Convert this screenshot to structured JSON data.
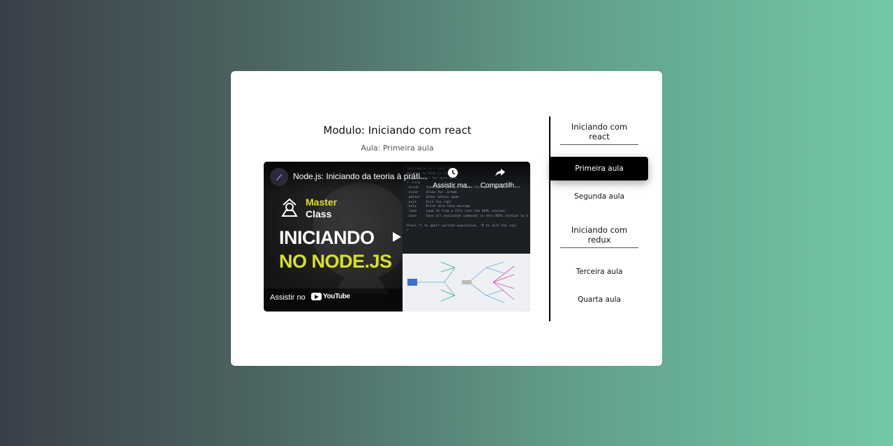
{
  "module": {
    "title": "Modulo: Iniciando com react",
    "subtitle": "Aula: Primeira aula"
  },
  "video": {
    "title": "Node.js: Iniciando da teoria à práti...",
    "watch_later": "Assistir ma...",
    "share": "Compartilh...",
    "thumb_master": "Master",
    "thumb_class": "Class",
    "thumb_line1": "INICIANDO",
    "thumb_line2": "NO NODE.JS",
    "watch_on": "Assistir no",
    "youtube": "YouTube",
    "icons": [
      "channel-avatar-icon",
      "clock-icon",
      "share-icon",
      "play-icon",
      "youtube-logo-icon"
    ],
    "accent": "#d8e21d"
  },
  "sidebar": {
    "sections": [
      {
        "title": "Iniciando com react",
        "lessons": [
          "Primeira aula",
          "Segunda aula"
        ]
      },
      {
        "title": "Iniciando com redux",
        "lessons": [
          "Terceira aula",
          "Quarta aula"
        ]
      }
    ],
    "active_lesson": "Primeira aula"
  },
  "colors": {
    "active_bg": "#000000",
    "active_text": "#ffffff",
    "card_bg": "#ffffff"
  }
}
